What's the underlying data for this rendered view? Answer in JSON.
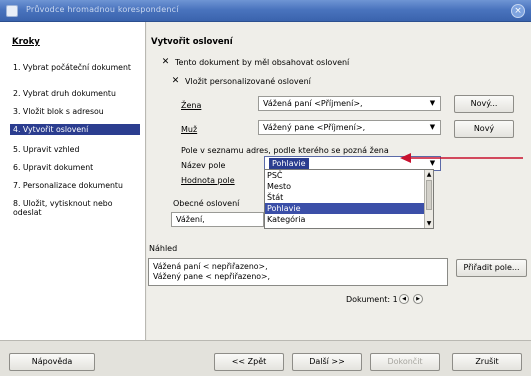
{
  "window": {
    "title": "Průvodce hromadnou korespondencí"
  },
  "sidebar": {
    "header": "Kroky",
    "steps": [
      {
        "label": "1. Vybrat počáteční dokument"
      },
      {
        "label": "2. Vybrat druh dokumentu"
      },
      {
        "label": "3. Vložit blok s adresou"
      },
      {
        "label": "4. Vytvořit oslovení"
      },
      {
        "label": "5. Upravit vzhled"
      },
      {
        "label": "6. Upravit dokument"
      },
      {
        "label": "7. Personalizace dokumentu"
      },
      {
        "label": "8. Uložit, vytisknout nebo odeslat"
      }
    ],
    "active_index": 3
  },
  "main": {
    "section_title": "Vytvořit oslovení",
    "cb_contains_greeting": {
      "label": "Tento dokument by měl obsahovat oslovení",
      "checked": true
    },
    "cb_personalized": {
      "label": "Vložit personalizované oslovení",
      "checked": true
    },
    "female": {
      "label": "Žena",
      "value": "Vážená paní <Příjmení>,",
      "button": "Nový..."
    },
    "male": {
      "label": "Muž",
      "value": "Vážený pane <Příjmení>,",
      "button": "Nový"
    },
    "field_hint": "Pole v seznamu adres, podle kterého se pozná žena",
    "field_name": {
      "label": "Název pole",
      "value": "Pohlavie"
    },
    "field_value": {
      "label": "Hodnota pole"
    },
    "dropdown_options": [
      "PSČ",
      "Mesto",
      "Štát",
      "Pohlavie",
      "Kategória"
    ],
    "dropdown_selected_index": 3,
    "general": {
      "label": "Obecné oslovení",
      "value": "Vážení,"
    },
    "preview": {
      "label": "Náhled",
      "lines": [
        "Vážená paní < nepřiřazeno>,",
        "Vážený pane < nepřiřazeno>,"
      ],
      "assign_button": "Přiřadit pole...",
      "document_label": "Dokument: 1"
    }
  },
  "footer": {
    "help": "Nápověda",
    "back": "<< Zpět",
    "next": "Další >>",
    "finish": "Dokončit",
    "cancel": "Zrušit"
  },
  "colors": {
    "selection": "#2b3d8f",
    "annotation_arrow": "#c8102e",
    "titlebar": "#4a74be"
  }
}
